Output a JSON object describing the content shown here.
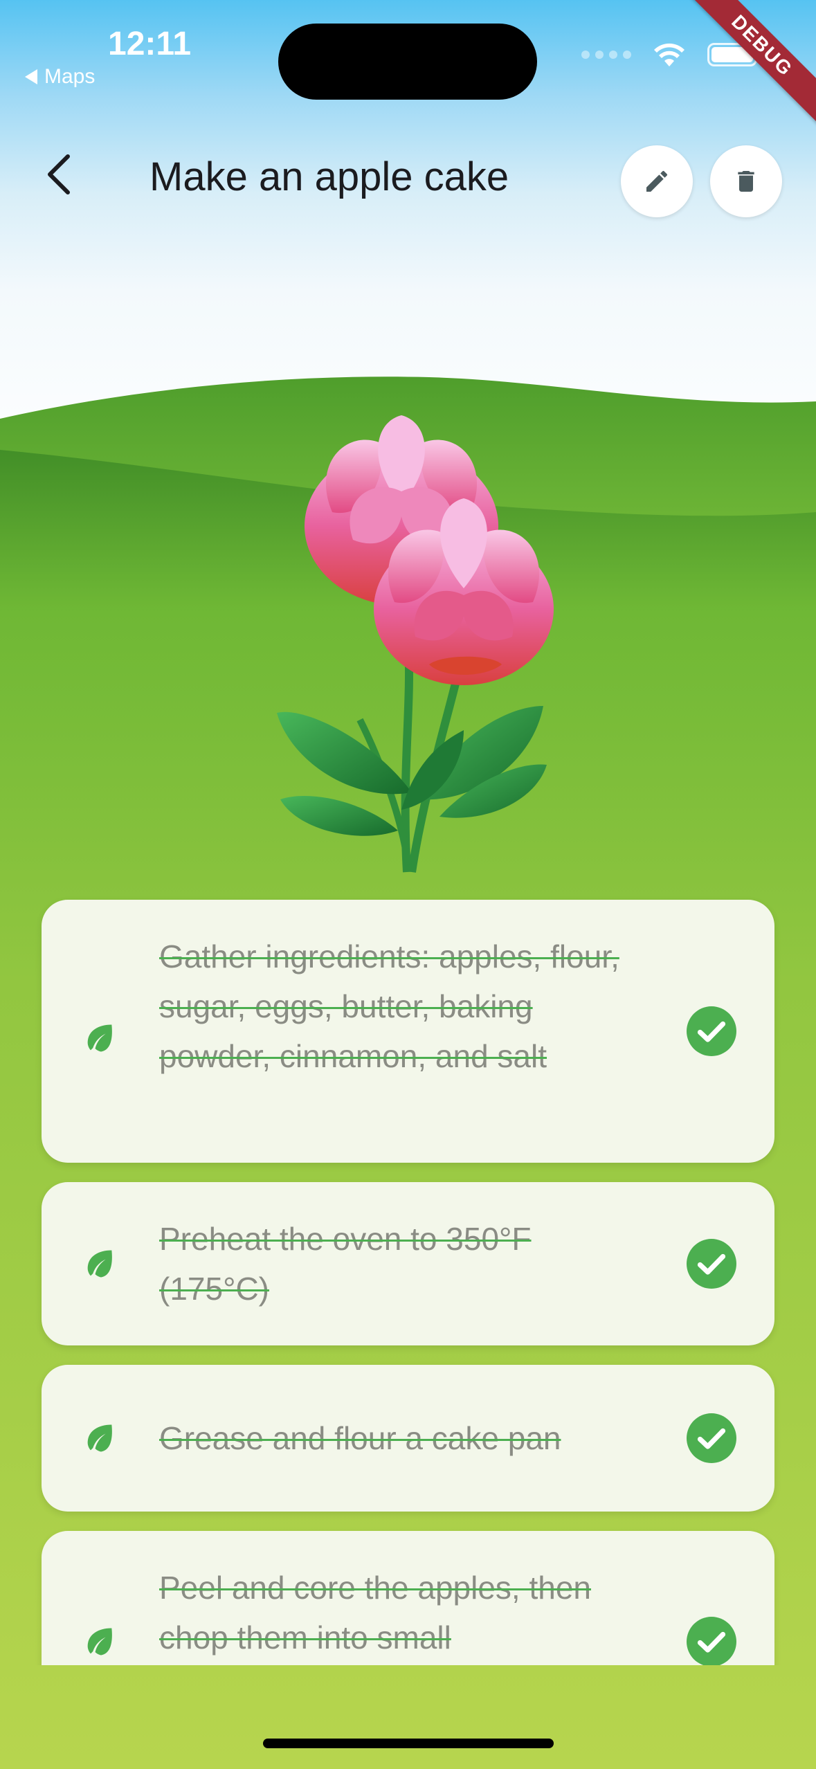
{
  "status_bar": {
    "time": "12:11",
    "back_app": "Maps"
  },
  "debug_banner": "DEBUG",
  "app_bar": {
    "title": "Make an apple cake",
    "back_icon": "chevron-left-icon",
    "edit_icon": "pencil-icon",
    "delete_icon": "trash-icon"
  },
  "illustration": "pink-flower-emoji",
  "tasks": [
    {
      "text": "Gather ingredients: apples, flour, sugar, eggs, butter, baking powder, cinnamon, and salt",
      "completed": true
    },
    {
      "text": "Preheat the oven to 350°F (175°C)",
      "completed": true
    },
    {
      "text": "Grease and flour a cake pan",
      "completed": true
    },
    {
      "text": "Peel and core the apples, then chop them into small",
      "completed": true
    }
  ],
  "colors": {
    "accent": "#4caf50",
    "card": "#f3f7ea",
    "grass": "#8dc63f",
    "debug": "#a32a36"
  }
}
